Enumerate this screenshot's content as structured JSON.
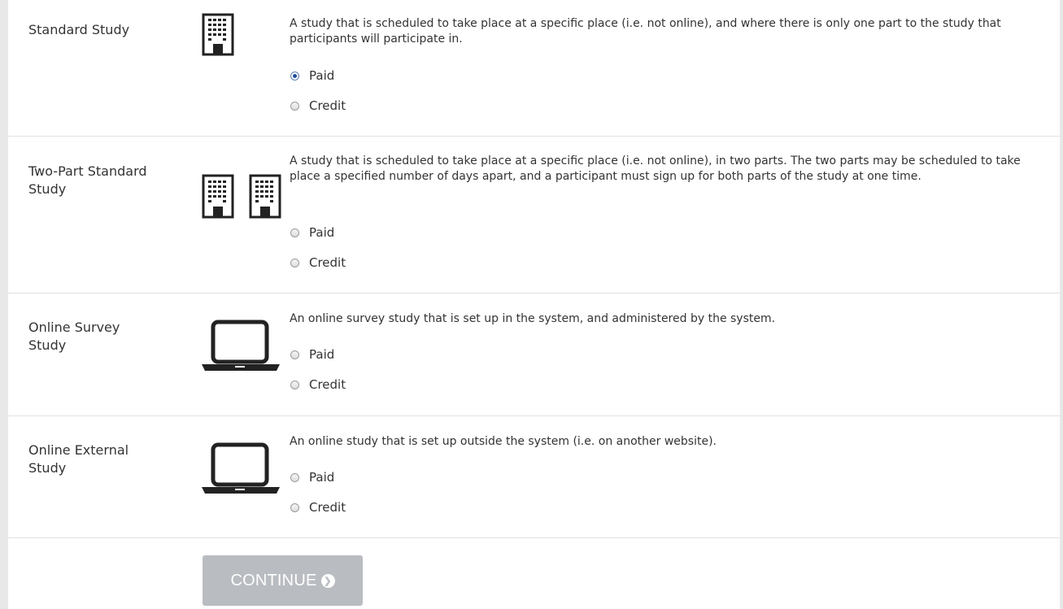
{
  "studies": [
    {
      "name": "Standard Study",
      "description": "A study that is scheduled to take place at a specific place (i.e. not online), and where there is only one part to the study that participants will participate in.",
      "icon": "building-icon",
      "options": [
        {
          "label": "Paid",
          "checked": true
        },
        {
          "label": "Credit",
          "checked": false
        }
      ]
    },
    {
      "name": "Two-Part Standard Study",
      "description": "A study that is scheduled to take place at a specific place (i.e. not online), in two parts. The two parts may be scheduled to take place a specified number of days apart, and a participant must sign up for both parts of the study at one time.",
      "icon": "two-buildings-icon",
      "options": [
        {
          "label": "Paid",
          "checked": false
        },
        {
          "label": "Credit",
          "checked": false
        }
      ]
    },
    {
      "name": "Online Survey Study",
      "description": "An online survey study that is set up in the system, and administered by the system.",
      "icon": "laptop-icon",
      "options": [
        {
          "label": "Paid",
          "checked": false
        },
        {
          "label": "Credit",
          "checked": false
        }
      ]
    },
    {
      "name": "Online External Study",
      "description": "An online study that is set up outside the system (i.e. on another website).",
      "icon": "laptop-icon",
      "options": [
        {
          "label": "Paid",
          "checked": false
        },
        {
          "label": "Credit",
          "checked": false
        }
      ]
    }
  ],
  "continue_button": {
    "label": "CONTINUE",
    "icon": "chevron-right-circle-icon",
    "enabled": false
  },
  "colors": {
    "button_disabled": "#b9bcc0",
    "divider": "#e1e1e1",
    "radio_checked": "#1d4f9c",
    "text": "#333333"
  }
}
